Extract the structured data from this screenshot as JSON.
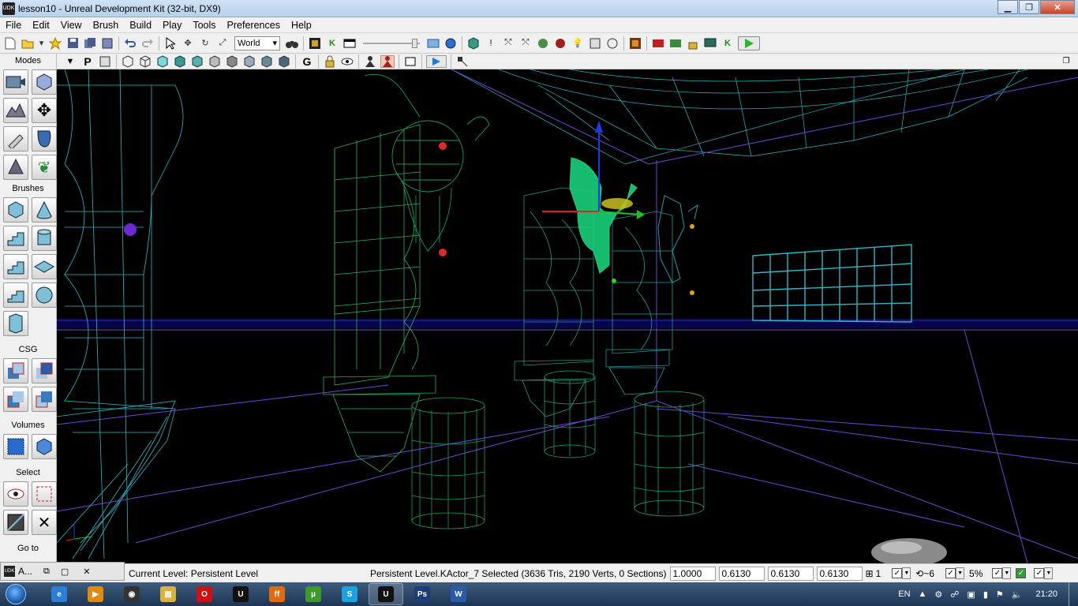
{
  "window": {
    "title": "lesson10 - Unreal Development Kit (32-bit, DX9)",
    "app_icon": "UDK",
    "minimize": "▁",
    "restore": "❐",
    "close": "✕"
  },
  "menu": [
    "File",
    "Edit",
    "View",
    "Brush",
    "Build",
    "Play",
    "Tools",
    "Preferences",
    "Help"
  ],
  "toolbar": {
    "coordinate_system": "World"
  },
  "left_panel": {
    "sections": {
      "modes": "Modes",
      "brushes": "Brushes",
      "csg": "CSG",
      "volumes": "Volumes",
      "select": "Select",
      "goto": "Go to"
    }
  },
  "viewport_toolbar": {
    "perspective_label": "P",
    "game_label": "G"
  },
  "statusbar": {
    "minibox_label": "A...",
    "current_level": "Current Level:  Persistent Level",
    "selection_info": "Persistent Level.KActor_7 Selected (3636 Tris, 2190 Verts, 0 Sections)",
    "scale_values": [
      "1.0000",
      "0.6130",
      "0.6130",
      "0.6130"
    ],
    "grid_value": "1",
    "rotation_snap": "~6",
    "scale_snap": "5%"
  },
  "taskbar": {
    "language": "EN",
    "clock": "21:20",
    "apps": [
      {
        "name": "internet-explorer",
        "label": "e",
        "color": "#2a7fd6"
      },
      {
        "name": "media-player",
        "label": "▶",
        "color": "#e08a12"
      },
      {
        "name": "game-app",
        "label": "◉",
        "color": "#333333"
      },
      {
        "name": "file-explorer",
        "label": "▤",
        "color": "#d9b23b"
      },
      {
        "name": "opera",
        "label": "O",
        "color": "#d01010"
      },
      {
        "name": "udk-editor",
        "label": "U",
        "color": "#111111"
      },
      {
        "name": "firefox",
        "label": "ff",
        "color": "#e06a10"
      },
      {
        "name": "utorrent",
        "label": "µ",
        "color": "#3c9a2c"
      },
      {
        "name": "skype",
        "label": "S",
        "color": "#1aa3e0"
      },
      {
        "name": "udk-active",
        "label": "U",
        "color": "#111111"
      },
      {
        "name": "photoshop",
        "label": "Ps",
        "color": "#1d3c78"
      },
      {
        "name": "word",
        "label": "W",
        "color": "#2a5aa8"
      }
    ]
  }
}
